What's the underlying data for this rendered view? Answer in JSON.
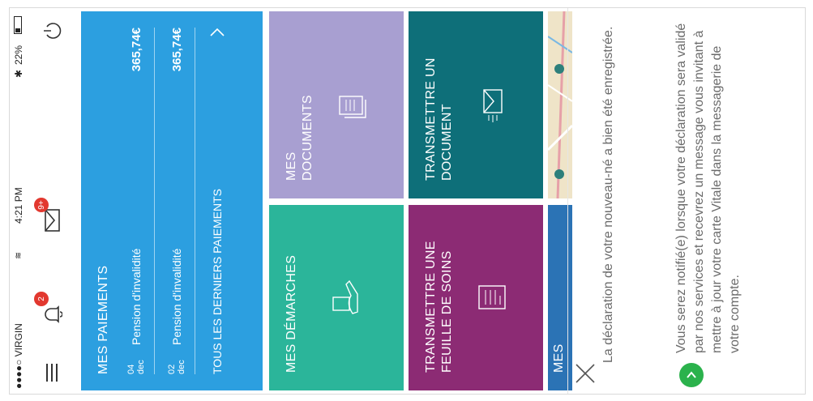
{
  "status": {
    "carrier": "●●●●○ VIRGIN",
    "time": "4:21 PM",
    "battery": "22%"
  },
  "nav": {
    "notifications_badge": "2",
    "messages_badge": "9+"
  },
  "payments": {
    "title": "MES PAIEMENTS",
    "items": [
      {
        "day": "04",
        "month": "dec",
        "label": "Pension d'invalidité",
        "amount": "365,74€"
      },
      {
        "day": "02",
        "month": "dec",
        "label": "Pension d'invalidité",
        "amount": "365,74€"
      }
    ],
    "all_link": "TOUS LES DERNIERS PAIEMENTS"
  },
  "tiles": {
    "demarches": "MES DÉMARCHES",
    "documents": "MES\nDOCUMENTS",
    "feuille": "TRANSMETTRE UNE\nFEUILLE DE SOINS",
    "document": "TRANSMETTRE UN\nDOCUMENT",
    "mes_bottom": "MES"
  },
  "message": {
    "line1": "La déclaration de votre nouveau-né a bien été enregistrée.",
    "line2": "Vous serez notifié(e) lorsque votre déclaration sera validé par nos services et recevrez un message vous invitant à mettre à jour votre carte Vitale dans la messagerie de votre compte."
  },
  "colors": {
    "payments": "#2c9fe0",
    "demarches": "#2bb59a",
    "documents": "#a89fd1",
    "feuille": "#8c2b74",
    "document": "#0e6f79",
    "mes": "#2b73b5",
    "check": "#2bb24c"
  }
}
